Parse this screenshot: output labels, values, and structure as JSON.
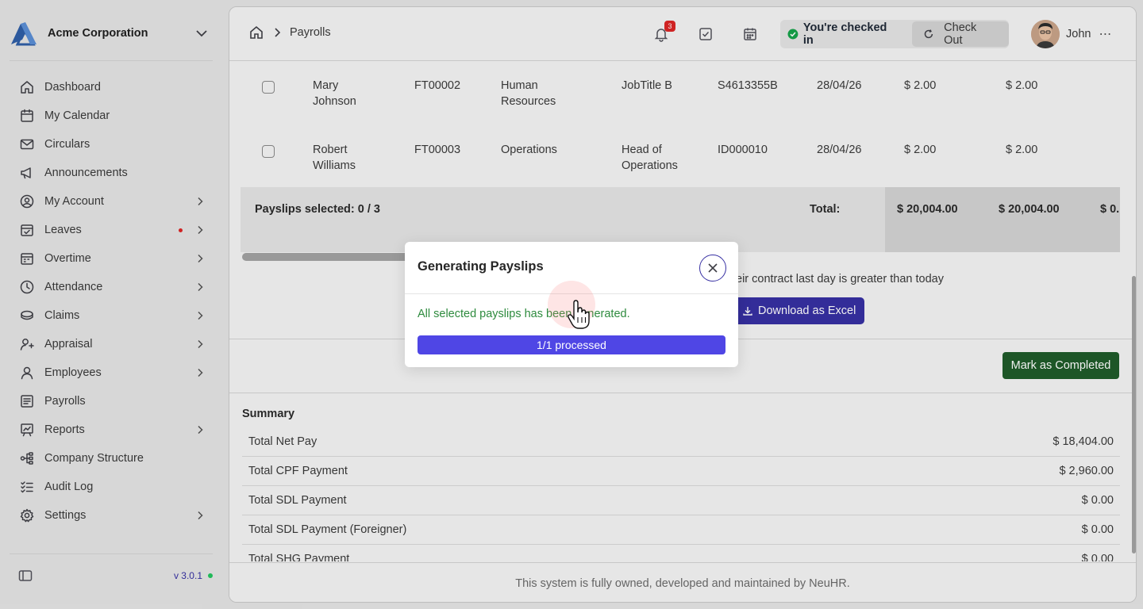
{
  "app": {
    "company_name": "Acme Corporation",
    "version": "v 3.0.1"
  },
  "sidebar": {
    "items": [
      {
        "label": "Dashboard",
        "icon": "home-icon",
        "chevron": false,
        "dot": false
      },
      {
        "label": "My Calendar",
        "icon": "calendar-icon",
        "chevron": false,
        "dot": false
      },
      {
        "label": "Circulars",
        "icon": "mail-icon",
        "chevron": false,
        "dot": false
      },
      {
        "label": "Announcements",
        "icon": "megaphone-icon",
        "chevron": false,
        "dot": false
      },
      {
        "label": "My Account",
        "icon": "user-circle-icon",
        "chevron": true,
        "dot": false
      },
      {
        "label": "Leaves",
        "icon": "calendar-check-icon",
        "chevron": true,
        "dot": true
      },
      {
        "label": "Overtime",
        "icon": "calendar-clock-icon",
        "chevron": true,
        "dot": false
      },
      {
        "label": "Attendance",
        "icon": "clock-icon",
        "chevron": true,
        "dot": false
      },
      {
        "label": "Claims",
        "icon": "coins-icon",
        "chevron": true,
        "dot": false
      },
      {
        "label": "Appraisal",
        "icon": "user-star-icon",
        "chevron": true,
        "dot": false
      },
      {
        "label": "Employees",
        "icon": "user-icon",
        "chevron": true,
        "dot": false
      },
      {
        "label": "Payrolls",
        "icon": "receipt-icon",
        "chevron": false,
        "dot": false
      },
      {
        "label": "Reports",
        "icon": "chart-icon",
        "chevron": true,
        "dot": false
      },
      {
        "label": "Company Structure",
        "icon": "org-structure-icon",
        "chevron": false,
        "dot": false
      },
      {
        "label": "Audit Log",
        "icon": "list-check-icon",
        "chevron": false,
        "dot": false
      },
      {
        "label": "Settings",
        "icon": "gear-icon",
        "chevron": true,
        "dot": false
      }
    ]
  },
  "header": {
    "breadcrumb": "Payrolls",
    "notification_count": "3",
    "checkin_status": "You're checked in",
    "checkout_label": "Check Out",
    "user_name": "John"
  },
  "table": {
    "rows": [
      {
        "name": "Mary Johnson",
        "name_l1": "Mary",
        "name_l2": "Johnson",
        "id": "FT00002",
        "dept_l1": "Human",
        "dept_l2": "Resources",
        "title_l1": "JobTitle B",
        "title_l2": "",
        "nric": "S4613355B",
        "date": "28/04/26",
        "amt1": "$ 2.00",
        "amt2": "$ 2.00"
      },
      {
        "name": "Robert Williams",
        "name_l1": "Robert",
        "name_l2": "Williams",
        "id": "FT00003",
        "dept_l1": "Operations",
        "dept_l2": "",
        "title_l1": "Head of",
        "title_l2": "Operations",
        "nric": "ID000010",
        "date": "28/04/26",
        "amt1": "$ 2.00",
        "amt2": "$ 2.00"
      }
    ],
    "selected_label": "Payslips selected: 0 / 3",
    "total_label": "Total:",
    "total_values": [
      "$ 20,004.00",
      "$ 20,004.00",
      "$ 0."
    ]
  },
  "note_text": "eir contract last day is greater than today",
  "download_excel_label": "Download as Excel",
  "mark_completed_label": "Mark as Completed",
  "summary": {
    "title": "Summary",
    "rows": [
      {
        "label": "Total Net Pay",
        "value": "$ 18,404.00"
      },
      {
        "label": "Total CPF Payment",
        "value": "$ 2,960.00"
      },
      {
        "label": "Total SDL Payment",
        "value": "$ 0.00"
      },
      {
        "label": "Total SDL Payment (Foreigner)",
        "value": "$ 0.00"
      },
      {
        "label": "Total SHG Payment",
        "value": "$ 0.00"
      }
    ]
  },
  "footer_text": "This system is fully owned, developed and maintained by NeuHR.",
  "modal": {
    "title": "Generating Payslips",
    "message": "All selected payslips has been generated.",
    "progress_label": "1/1 processed",
    "progress_fraction": 1.0
  },
  "colors": {
    "accent": "#3730a3",
    "progress": "#4f46e5",
    "success_text": "#2e8b3e",
    "complete_button": "#1f5c2a",
    "notification": "#dc2626"
  }
}
